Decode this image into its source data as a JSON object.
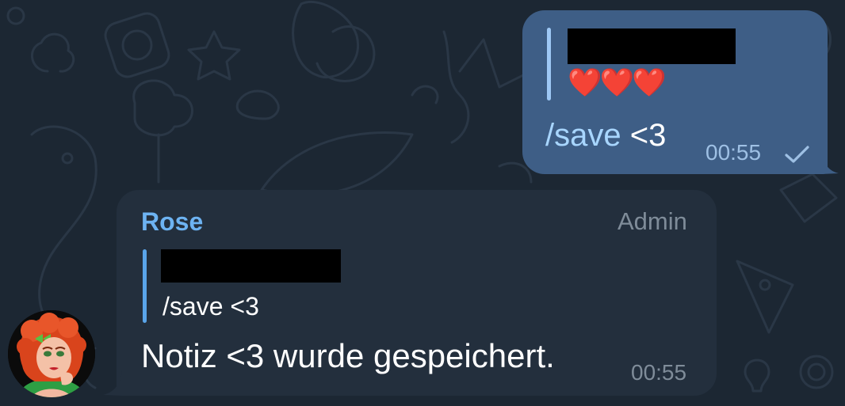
{
  "background": {
    "color": "#1c2733",
    "pattern": "doodle-wallpaper"
  },
  "outgoing_message": {
    "bubble_color": "#3e5e86",
    "reply_quote": {
      "sender_redacted": true,
      "text": "❤️❤️❤️"
    },
    "command": "/save",
    "text_rest": " <3",
    "time": "00:55",
    "status_icon": "single-check-icon"
  },
  "incoming_message": {
    "bubble_color": "#232f3d",
    "sender": "Rose",
    "sender_color": "#6db3f2",
    "badge": "Admin",
    "reply_quote": {
      "sender_redacted": true,
      "text": "/save <3"
    },
    "text": "Notiz <3 wurde gespeichert.",
    "time": "00:55",
    "avatar_icon": "cartoon-woman-avatar"
  }
}
